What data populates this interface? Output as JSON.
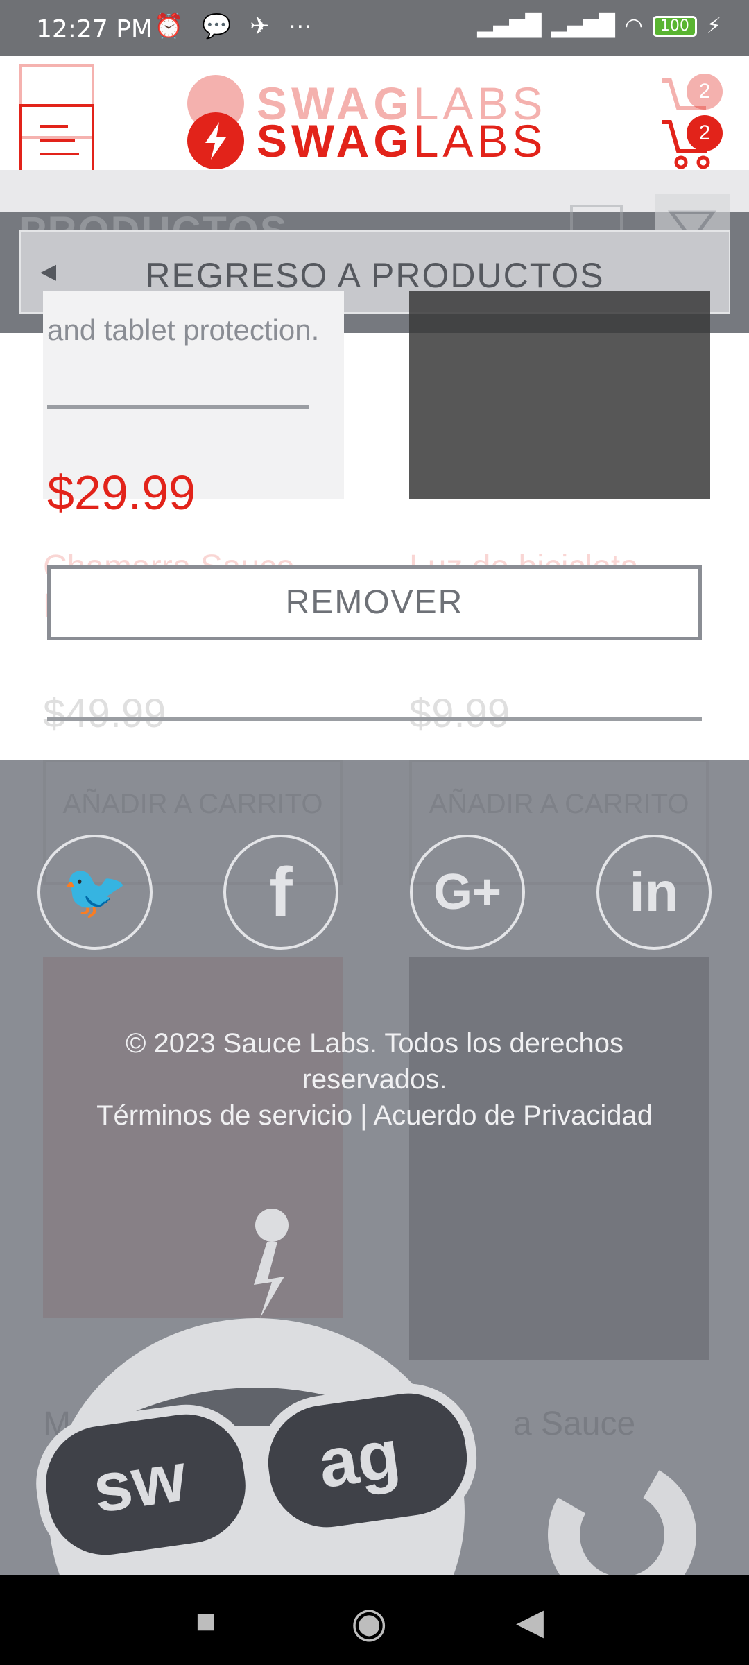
{
  "status_bar": {
    "time": "12:27 PM",
    "left_icons": "⏰ 💬 ✈ ⋯",
    "battery": "100"
  },
  "header": {
    "logo_bold": "SWAG",
    "logo_light": "LABS",
    "cart_count": "2"
  },
  "subheader": {
    "title": "PRODUCTOS",
    "back_label": "REGRESO A PRODUCTOS"
  },
  "detail": {
    "desc_fragment": "and tablet protection.",
    "price": "$29.99",
    "remove_label": "REMOVER"
  },
  "background_products": [
    {
      "name": "Chamarra Sauce Labs",
      "price": "$49.99",
      "button": "AÑADIR A CARRITO"
    },
    {
      "name": "Luz de bicicleta Sauce Labs",
      "price": "$9.99",
      "button": "AÑADIR A CARRITO"
    }
  ],
  "background_labels": {
    "partial_left": "M",
    "partial_right": "a Sauce"
  },
  "footer": {
    "copyright": "© 2023 Sauce Labs. Todos los derechos reservados.",
    "links": "Términos de servicio | Acuerdo de Privacidad",
    "mascot_text_left": "sw",
    "mascot_text_right": "ag"
  },
  "social": {
    "twitter": "🐦",
    "facebook": "f",
    "google": "G+",
    "linkedin": "in"
  },
  "navbar": {
    "recents": "■",
    "home": "◉",
    "back": "◀"
  }
}
